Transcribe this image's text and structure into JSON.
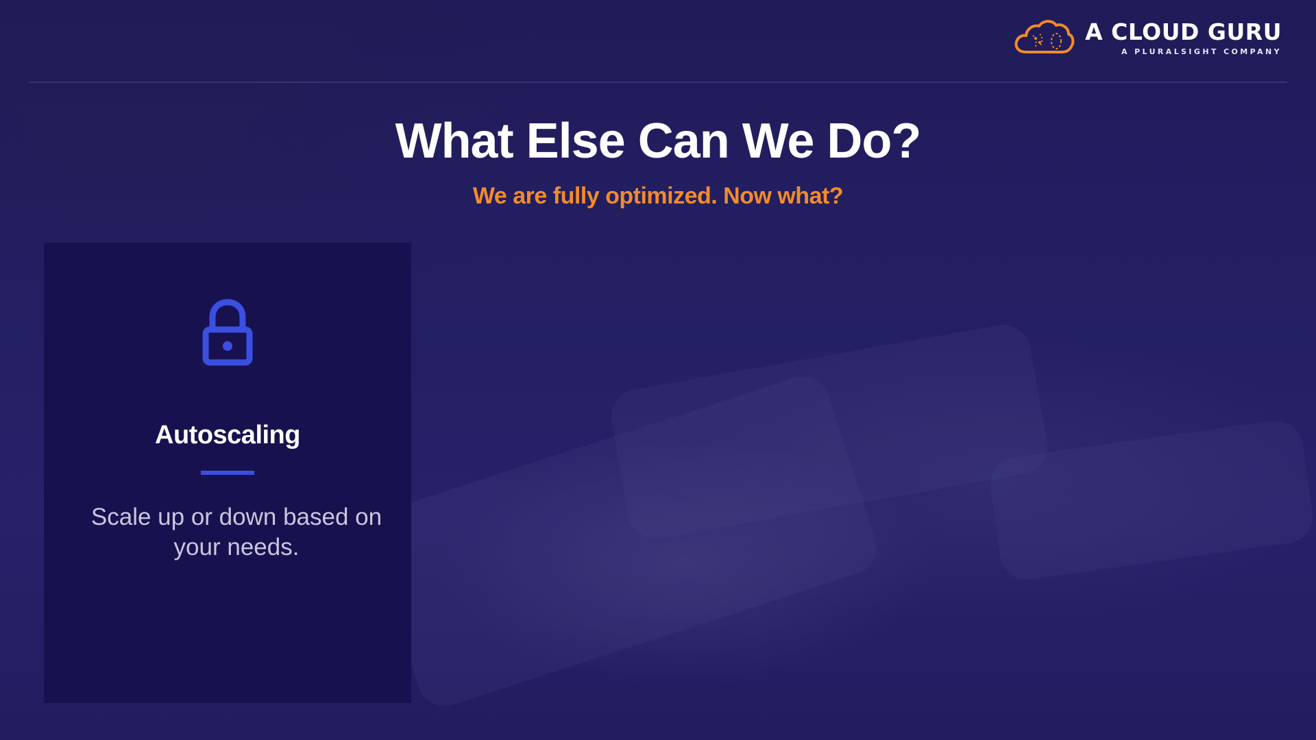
{
  "header": {
    "brand": "A CLOUD GURU",
    "brand_sub": "A PLURALSIGHT COMPANY",
    "logo_icon": "cloud-logo-icon",
    "logo_color": "#f28b2c"
  },
  "slide": {
    "title": "What Else Can We Do?",
    "subtitle": "We are fully optimized. Now what?",
    "subtitle_color": "#f28b2c"
  },
  "card": {
    "icon": "lock-icon",
    "icon_color": "#3b4fe0",
    "title": "Autoscaling",
    "description": "Scale up or down based on your needs."
  },
  "theme": {
    "background": "#1f1b5c",
    "card_background": "#17124f",
    "accent": "#3b4fe0"
  }
}
